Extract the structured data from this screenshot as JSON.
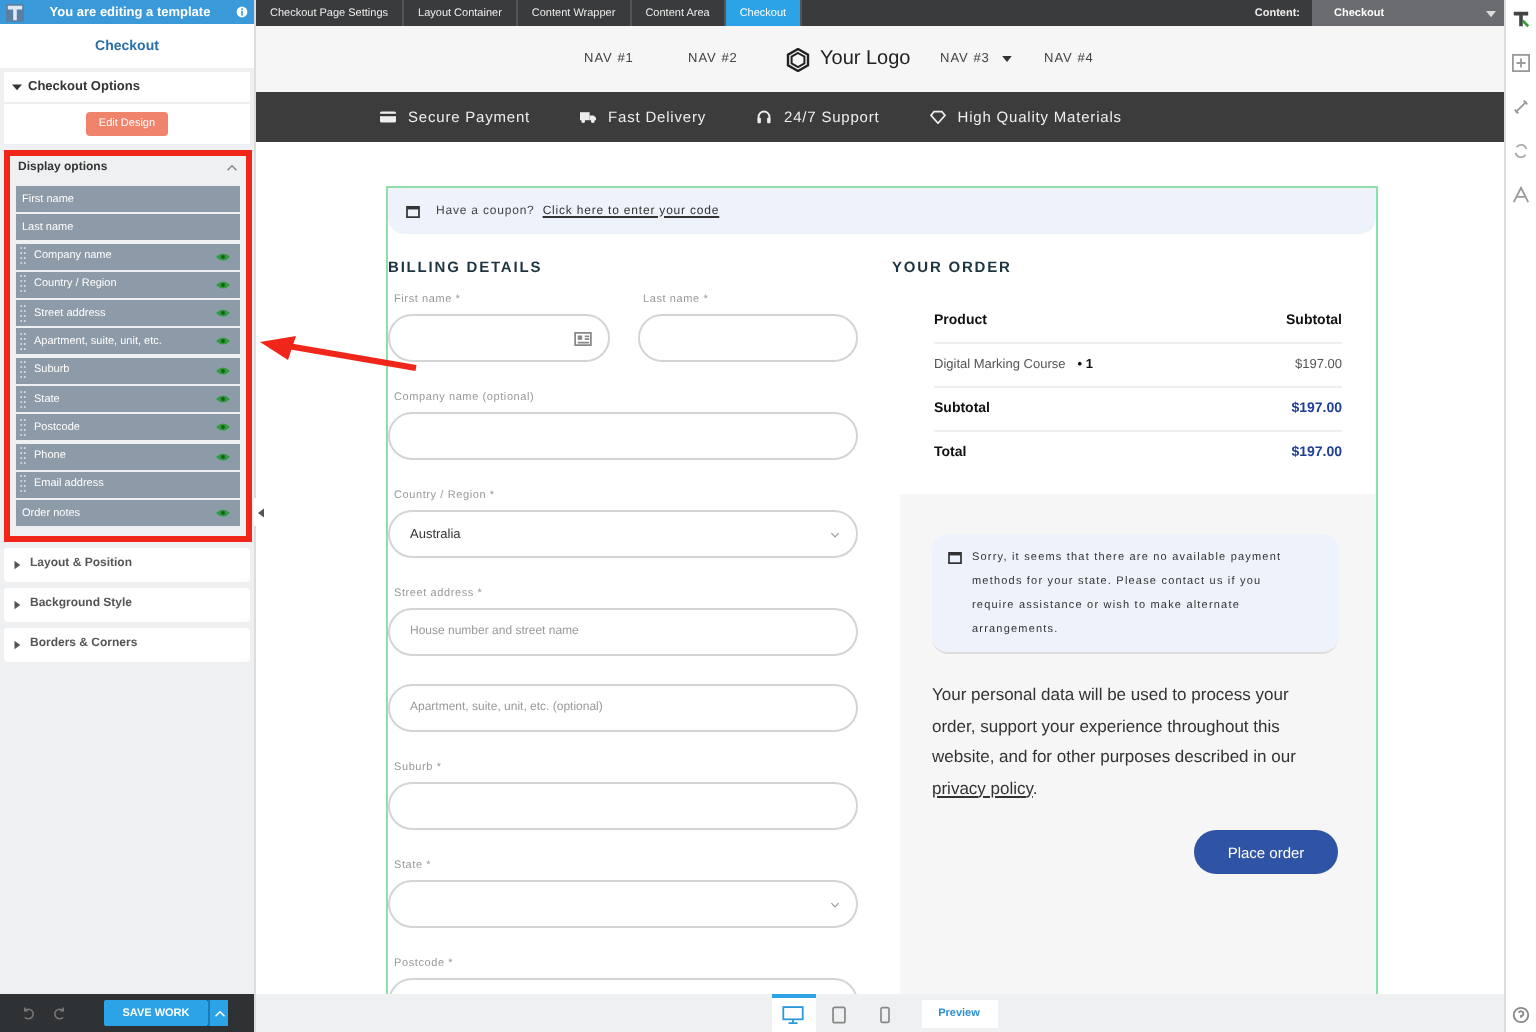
{
  "editor_banner": {
    "text": "You are editing a template"
  },
  "sidebar": {
    "title": "Checkout",
    "options_section": {
      "title": "Checkout Options",
      "expanded": true,
      "button": "Edit Design"
    },
    "display_options": {
      "title": "Display options",
      "expanded": true,
      "items": [
        {
          "label": "First name",
          "draggable": false,
          "visible": false
        },
        {
          "label": "Last name",
          "draggable": false,
          "visible": false
        },
        {
          "label": "Company name",
          "draggable": true,
          "visible": true
        },
        {
          "label": "Country / Region",
          "draggable": true,
          "visible": true
        },
        {
          "label": "Street address",
          "draggable": true,
          "visible": true
        },
        {
          "label": "Apartment, suite, unit, etc.",
          "draggable": true,
          "visible": true
        },
        {
          "label": "Suburb",
          "draggable": true,
          "visible": true
        },
        {
          "label": "State",
          "draggable": true,
          "visible": true
        },
        {
          "label": "Postcode",
          "draggable": true,
          "visible": true
        },
        {
          "label": "Phone",
          "draggable": true,
          "visible": true
        },
        {
          "label": "Email address",
          "draggable": true,
          "visible": false
        },
        {
          "label": "Order notes",
          "draggable": false,
          "visible": true
        }
      ]
    },
    "collapsed_sections": [
      {
        "title": "Layout & Position"
      },
      {
        "title": "Background Style"
      },
      {
        "title": "Borders & Corners"
      }
    ],
    "save_button": "SAVE WORK"
  },
  "breadcrumbs": [
    {
      "label": "Checkout Page Settings",
      "selected": false
    },
    {
      "label": "Layout Container",
      "selected": false
    },
    {
      "label": "Content Wrapper",
      "selected": false
    },
    {
      "label": "Content Area",
      "selected": false
    },
    {
      "label": "Checkout",
      "selected": true
    }
  ],
  "content_selector": {
    "label": "Content:",
    "value": "Checkout"
  },
  "site_nav": {
    "left": [
      {
        "label": "NAV #1",
        "has_dropdown": false
      },
      {
        "label": "NAV #2",
        "has_dropdown": false
      }
    ],
    "logo": "Your Logo",
    "right": [
      {
        "label": "NAV #3",
        "has_dropdown": true
      },
      {
        "label": "NAV #4",
        "has_dropdown": false
      }
    ]
  },
  "features": [
    {
      "kind": "card",
      "label": "Secure Payment"
    },
    {
      "kind": "truck",
      "label": "Fast Delivery"
    },
    {
      "kind": "headset",
      "label": "24/7 Support"
    },
    {
      "kind": "diamond",
      "label": "High Quality Materials"
    }
  ],
  "checkout": {
    "coupon": {
      "text": "Have a coupon?",
      "link": "Click here to enter your code"
    },
    "billing": {
      "title": "BILLING DETAILS",
      "rows": [
        [
          {
            "label": "First name *",
            "kind": "text",
            "autofill": true
          },
          {
            "label": "Last name *",
            "kind": "text"
          }
        ],
        [
          {
            "label": "Company name (optional)",
            "kind": "text"
          }
        ],
        [
          {
            "label": "Country / Region *",
            "kind": "select",
            "value": "Australia"
          }
        ],
        [
          {
            "label": "Street address *",
            "kind": "text",
            "placeholder": "House number and street name"
          }
        ],
        [
          {
            "kind": "text",
            "placeholder": "Apartment, suite, unit, etc. (optional)"
          }
        ],
        [
          {
            "label": "Suburb *",
            "kind": "text"
          }
        ],
        [
          {
            "label": "State *",
            "kind": "select"
          }
        ],
        [
          {
            "label": "Postcode *",
            "kind": "text"
          }
        ]
      ]
    },
    "order": {
      "title": "YOUR ORDER",
      "columns": [
        "Product",
        "Subtotal"
      ],
      "item": {
        "name": "Digital Marking Course",
        "quantity": "• 1",
        "amount": "$197.00"
      },
      "totals": [
        {
          "label": "Subtotal",
          "amount": "$197.00"
        },
        {
          "label": "Total",
          "amount": "$197.00"
        }
      ],
      "notice": "Sorry, it seems that there are no available payment methods for your state. Please contact us if you require assistance or wish to make alternate arrangements.",
      "privacy": {
        "text": "Your personal data will be used to process your order, support your experience throughout this website, and for other purposes described in our",
        "link": "privacy policy",
        "end": "."
      },
      "button": "Place order"
    }
  },
  "devices": [
    {
      "kind": "desktop",
      "selected": true
    },
    {
      "kind": "tablet",
      "selected": false
    },
    {
      "kind": "phone",
      "selected": false
    }
  ],
  "preview_button": "Preview"
}
